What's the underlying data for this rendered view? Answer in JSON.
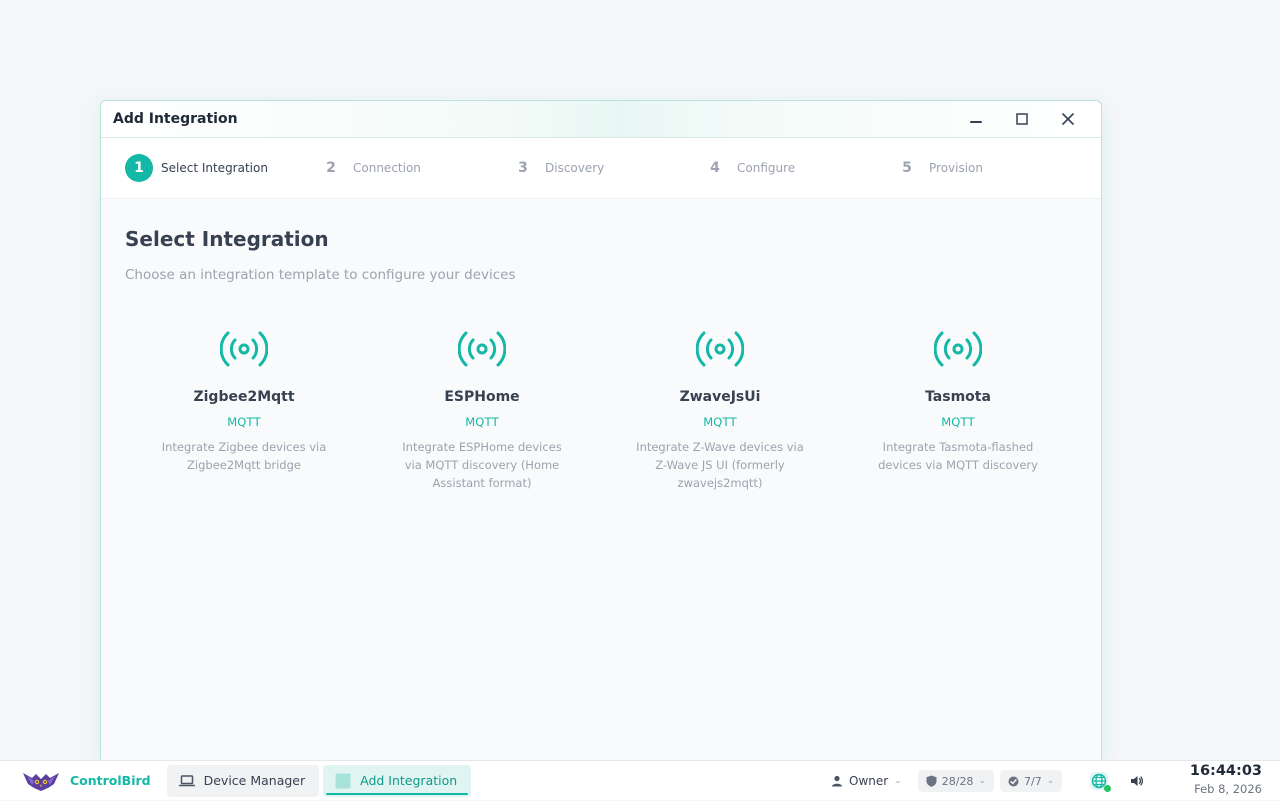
{
  "window": {
    "title": "Add Integration"
  },
  "stepper": {
    "steps": [
      {
        "num": "1",
        "label": "Select Integration"
      },
      {
        "num": "2",
        "label": "Connection"
      },
      {
        "num": "3",
        "label": "Discovery"
      },
      {
        "num": "4",
        "label": "Configure"
      },
      {
        "num": "5",
        "label": "Provision"
      }
    ],
    "active_step": "1"
  },
  "content": {
    "heading": "Select Integration",
    "subheading": "Choose an integration template to configure your devices",
    "integrations": [
      {
        "name": "Zigbee2Mqtt",
        "protocol": "MQTT",
        "description": "Integrate Zigbee devices via Zigbee2Mqtt bridge",
        "icon": "radio-signal-icon"
      },
      {
        "name": "ESPHome",
        "protocol": "MQTT",
        "description": "Integrate ESPHome devices via MQTT discovery (Home Assistant format)",
        "icon": "radio-signal-icon"
      },
      {
        "name": "ZwaveJsUi",
        "protocol": "MQTT",
        "description": "Integrate Z-Wave devices via Z-Wave JS UI (formerly zwavejs2mqtt)",
        "icon": "radio-signal-icon"
      },
      {
        "name": "Tasmota",
        "protocol": "MQTT",
        "description": "Integrate Tasmota-flashed devices via MQTT discovery",
        "icon": "radio-signal-icon"
      }
    ]
  },
  "taskbar": {
    "brand": "ControlBird",
    "tasks": [
      {
        "label": "Device Manager",
        "icon": "laptop-icon"
      },
      {
        "label": "Add Integration",
        "icon": "app-square-icon"
      }
    ],
    "user": "Owner",
    "shield_count": "28/28",
    "check_count": "7/7",
    "time": "16:44:03",
    "date": "Feb 8, 2026"
  },
  "colors": {
    "accent": "#14b8a6",
    "background": "#f4f6f7"
  }
}
